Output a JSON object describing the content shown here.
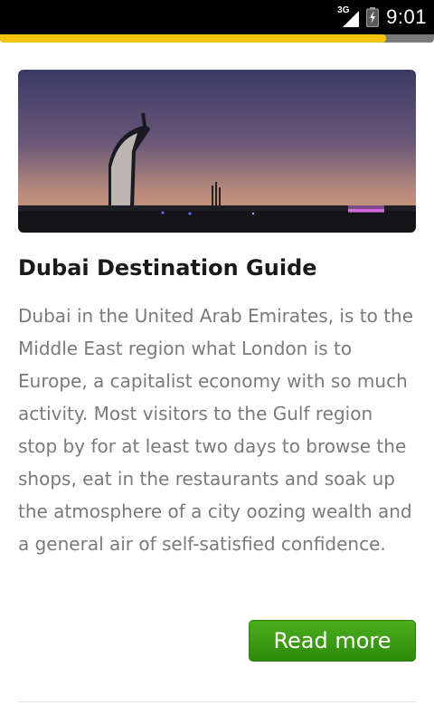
{
  "status_bar": {
    "network_label": "3G",
    "time": "9:01"
  },
  "load_progress": 0.89,
  "article": {
    "image_icon": "dubai-skyline-image",
    "title": "Dubai Destination Guide",
    "description": "Dubai in the United Arab Emirates, is to the Middle East region what London is to Europe, a capitalist economy with so much activity. Most visitors to the Gulf region stop by for at least two days to browse the shops, eat in the restaurants and soak up the atmosphere of a city oozing wealth and a general air of self-satisfied confidence.",
    "read_more_label": "Read more"
  },
  "colors": {
    "accent_progress": "#f5c400",
    "button_green": "#3a9a14",
    "text_gray": "#7a7a7a"
  }
}
